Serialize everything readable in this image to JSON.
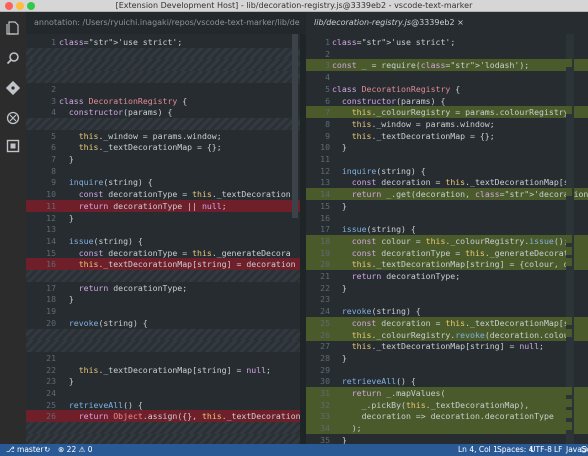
{
  "window": {
    "title": "[Extension Development Host] - lib/decoration-registry.js@3339eb2 - vscode-text-marker"
  },
  "tabs": [
    {
      "label": "annotation: /Users/ryuichi.inagaki/repos/vscode-text-marker/lib/decoration-registry.js"
    },
    {
      "label": "lib/decoration-registry.js",
      "suffix": "@3339eb2 ×"
    }
  ],
  "left_pane": {
    "lines": [
      {
        "n": "1",
        "code": "'use strict';",
        "hl": ""
      },
      {
        "n": "",
        "code": "",
        "hl": "hatch"
      },
      {
        "n": "",
        "code": "",
        "hl": "hatch"
      },
      {
        "n": "",
        "code": "",
        "hl": "hatch"
      },
      {
        "n": "2",
        "code": "",
        "hl": ""
      },
      {
        "n": "3",
        "code": "class DecorationRegistry {",
        "hl": ""
      },
      {
        "n": "4",
        "code": "  constructor(params) {",
        "hl": ""
      },
      {
        "n": "",
        "code": "",
        "hl": "hatch"
      },
      {
        "n": "5",
        "code": "    this._window = params.window;",
        "hl": ""
      },
      {
        "n": "6",
        "code": "    this._textDecorationMap = {};",
        "hl": ""
      },
      {
        "n": "7",
        "code": "  }",
        "hl": ""
      },
      {
        "n": "8",
        "code": "",
        "hl": ""
      },
      {
        "n": "9",
        "code": "  inquire(string) {",
        "hl": ""
      },
      {
        "n": "10",
        "code": "    const decorationType = this._textDecoration",
        "hl": ""
      },
      {
        "n": "11",
        "code": "    return decorationType || null;",
        "hl": "del"
      },
      {
        "n": "12",
        "code": "  }",
        "hl": ""
      },
      {
        "n": "13",
        "code": "",
        "hl": ""
      },
      {
        "n": "14",
        "code": "  issue(string) {",
        "hl": ""
      },
      {
        "n": "15",
        "code": "    const decorationType = this._generateDecora",
        "hl": ""
      },
      {
        "n": "16",
        "code": "    this._textDecorationMap[string] = decoration",
        "hl": "del"
      },
      {
        "n": "",
        "code": "",
        "hl": "hatch"
      },
      {
        "n": "17",
        "code": "    return decorationType;",
        "hl": ""
      },
      {
        "n": "18",
        "code": "  }",
        "hl": ""
      },
      {
        "n": "19",
        "code": "",
        "hl": ""
      },
      {
        "n": "20",
        "code": "  revoke(string) {",
        "hl": ""
      },
      {
        "n": "",
        "code": "",
        "hl": "hatch"
      },
      {
        "n": "",
        "code": "",
        "hl": "hatch"
      },
      {
        "n": "21",
        "code": "",
        "hl": ""
      },
      {
        "n": "22",
        "code": "    this._textDecorationMap[string] = null;",
        "hl": ""
      },
      {
        "n": "23",
        "code": "  }",
        "hl": ""
      },
      {
        "n": "24",
        "code": "",
        "hl": ""
      },
      {
        "n": "25",
        "code": "  retrieveAll() {",
        "hl": ""
      },
      {
        "n": "26",
        "code": "    return Object.assign({}, this._textDecoration",
        "hl": "del"
      },
      {
        "n": "",
        "code": "",
        "hl": "hatch"
      },
      {
        "n": "",
        "code": "",
        "hl": "hatch"
      }
    ]
  },
  "right_pane": {
    "lines": [
      {
        "n": "1",
        "code": "'use strict';",
        "hl": ""
      },
      {
        "n": "2",
        "code": "",
        "hl": ""
      },
      {
        "n": "3",
        "code": "const _ = require('lodash');",
        "hl": "ins"
      },
      {
        "n": "4",
        "code": "",
        "hl": ""
      },
      {
        "n": "5",
        "code": "class DecorationRegistry {",
        "hl": ""
      },
      {
        "n": "6",
        "code": "  constructor(params) {",
        "hl": ""
      },
      {
        "n": "7",
        "code": "    this._colourRegistry = params.colourRegistry",
        "hl": "ins"
      },
      {
        "n": "8",
        "code": "    this._window = params.window;",
        "hl": ""
      },
      {
        "n": "9",
        "code": "    this._textDecorationMap = {};",
        "hl": ""
      },
      {
        "n": "10",
        "code": "  }",
        "hl": ""
      },
      {
        "n": "11",
        "code": "",
        "hl": ""
      },
      {
        "n": "12",
        "code": "  inquire(string) {",
        "hl": ""
      },
      {
        "n": "13",
        "code": "    const decoration = this._textDecorationMap[s",
        "hl": ""
      },
      {
        "n": "14",
        "code": "    return _.get(decoration, 'decorationType', n",
        "hl": "ins"
      },
      {
        "n": "15",
        "code": "  }",
        "hl": ""
      },
      {
        "n": "16",
        "code": "",
        "hl": ""
      },
      {
        "n": "17",
        "code": "  issue(string) {",
        "hl": ""
      },
      {
        "n": "18",
        "code": "    const colour = this._colourRegistry.issue();",
        "hl": "ins"
      },
      {
        "n": "19",
        "code": "    const decorationType = this._generateDecorat",
        "hl": "ins"
      },
      {
        "n": "20",
        "code": "    this._textDecorationMap[string] = {colour, d",
        "hl": "ins"
      },
      {
        "n": "21",
        "code": "    return decorationType;",
        "hl": ""
      },
      {
        "n": "22",
        "code": "  }",
        "hl": ""
      },
      {
        "n": "23",
        "code": "",
        "hl": ""
      },
      {
        "n": "24",
        "code": "  revoke(string) {",
        "hl": ""
      },
      {
        "n": "25",
        "code": "    const decoration = this._textDecorationMap[s",
        "hl": "ins"
      },
      {
        "n": "26",
        "code": "    this._colourRegistry.revoke(decoration.colou",
        "hl": "ins"
      },
      {
        "n": "27",
        "code": "    this._textDecorationMap[string] = null;",
        "hl": ""
      },
      {
        "n": "28",
        "code": "  }",
        "hl": ""
      },
      {
        "n": "29",
        "code": "",
        "hl": ""
      },
      {
        "n": "30",
        "code": "  retrieveAll() {",
        "hl": ""
      },
      {
        "n": "31",
        "code": "    return _.mapValues(",
        "hl": "ins"
      },
      {
        "n": "32",
        "code": "      _.pickBy(this._textDecorationMap),",
        "hl": "ins"
      },
      {
        "n": "33",
        "code": "      decoration => decoration.decorationType",
        "hl": "ins"
      },
      {
        "n": "34",
        "code": "    );",
        "hl": "ins"
      },
      {
        "n": "35",
        "code": "  }",
        "hl": ""
      }
    ]
  },
  "statusbar": {
    "branch": "master",
    "sync_icon": "↻",
    "errors": "22",
    "warnings": "0",
    "position": "Ln 4, Col 1",
    "indent": "Spaces: 4",
    "encoding": "UTF-8",
    "eol": "LF",
    "language": "JavaScript",
    "smiley": "☺"
  },
  "activity_icons": [
    "explorer-icon",
    "search-icon",
    "git-icon",
    "debug-icon",
    "extensions-icon"
  ],
  "colors": {
    "editor_bg": "#262c30",
    "deleted": "#6e1f2a",
    "inserted": "#4a5a2a",
    "statusbar": "#2a5a95"
  }
}
